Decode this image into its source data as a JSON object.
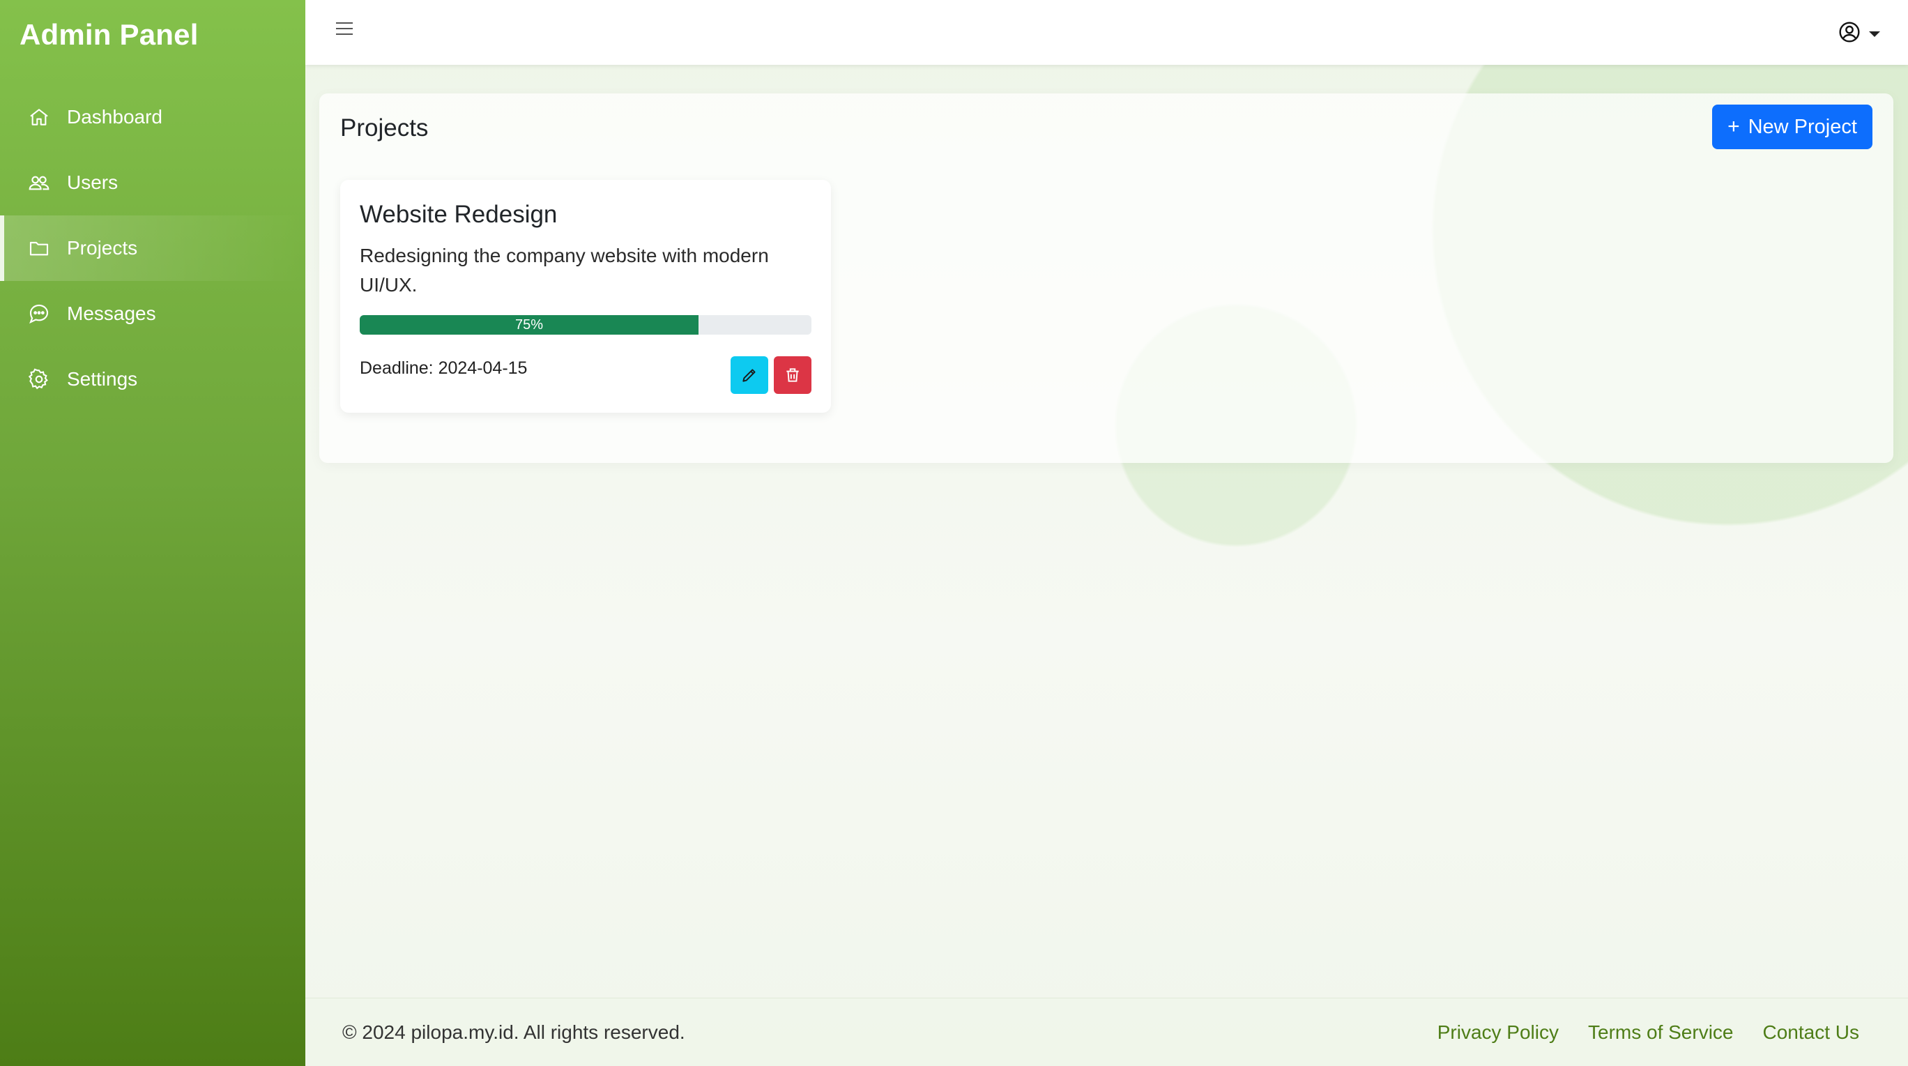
{
  "sidebar": {
    "brand": "Admin Panel",
    "items": [
      {
        "label": "Dashboard",
        "icon": "home-icon",
        "active": false
      },
      {
        "label": "Users",
        "icon": "users-icon",
        "active": false
      },
      {
        "label": "Projects",
        "icon": "folder-icon",
        "active": true
      },
      {
        "label": "Messages",
        "icon": "chat-icon",
        "active": false
      },
      {
        "label": "Settings",
        "icon": "gear-icon",
        "active": false
      }
    ]
  },
  "topbar": {
    "menu_icon": "hamburger-icon",
    "user_icon": "user-circle-icon"
  },
  "main": {
    "title": "Projects",
    "new_button": {
      "icon": "plus-icon",
      "label": "New Project"
    },
    "projects": [
      {
        "title": "Website Redesign",
        "description": "Redesigning the company website with modern UI/UX.",
        "progress": 75,
        "progress_label": "75%",
        "deadline": "Deadline: 2024-04-15",
        "actions": [
          "edit-button",
          "delete-button"
        ]
      }
    ]
  },
  "footer": {
    "copyright": "© 2024 pilopa.my.id. All rights reserved.",
    "links": [
      "Privacy Policy",
      "Terms of Service",
      "Contact Us"
    ]
  },
  "colors": {
    "sidebar_top": "#84c14b",
    "sidebar_bottom": "#4d7d16",
    "primary": "#0d6efd",
    "success": "#198754",
    "info": "#0dcaf0",
    "danger": "#dc3545",
    "footer_link": "#4e7d17"
  }
}
